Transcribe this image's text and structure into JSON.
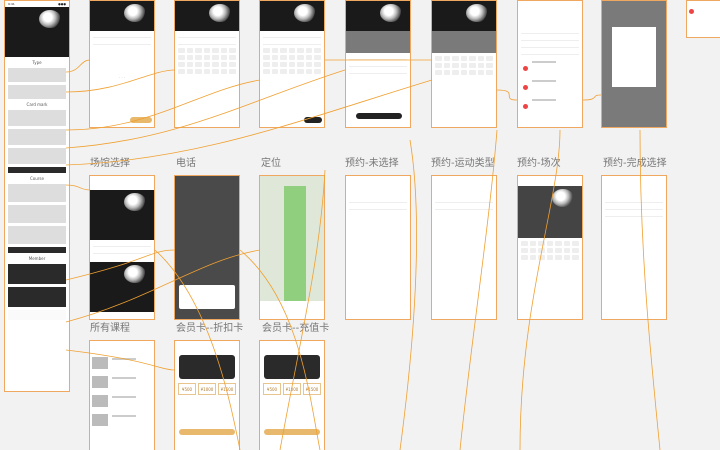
{
  "screens": [
    {
      "id": "home",
      "label": ""
    },
    {
      "id": "venue_select",
      "label": "场馆选择"
    },
    {
      "id": "phone",
      "label": "电话"
    },
    {
      "id": "location",
      "label": "定位"
    },
    {
      "id": "booking_unselected",
      "label": "预约-未选择"
    },
    {
      "id": "booking_sport",
      "label": "预约-运动类型"
    },
    {
      "id": "booking_session",
      "label": "预约-场次"
    },
    {
      "id": "booking_done",
      "label": "预约-完成选择"
    },
    {
      "id": "all_courses",
      "label": "所有课程"
    },
    {
      "id": "card_discount",
      "label": "会员卡--折扣卡"
    },
    {
      "id": "card_stored",
      "label": "会员卡--充值卡"
    }
  ],
  "home": {
    "section_type": "Type",
    "section_venue": "Card mark",
    "section_courses": "Course",
    "section_member": "Member"
  },
  "card": {
    "amounts": [
      "¥500",
      "¥1000",
      "¥1500"
    ]
  },
  "colors": {
    "connector": "#f0a030",
    "artboard_border": "#f0a860",
    "canvas": "#f2f2f2"
  }
}
